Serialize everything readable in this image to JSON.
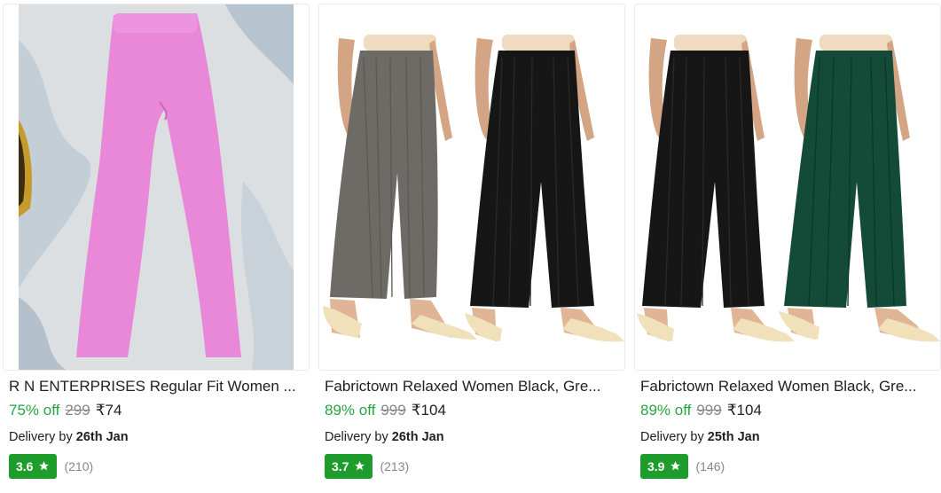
{
  "products": [
    {
      "title": "R N ENTERPRISES Regular Fit Women ...",
      "discount": "75% off",
      "mrp": "299",
      "price": "₹74",
      "delivery_prefix": "Delivery by",
      "delivery_date": "26th Jan",
      "rating": "3.6",
      "reviews": "(210)",
      "image_icon": "pink-trousers-image",
      "colors": [
        "#e987d9"
      ]
    },
    {
      "title": "Fabrictown Relaxed Women Black, Gre...",
      "discount": "89% off",
      "mrp": "999",
      "price": "₹104",
      "delivery_prefix": "Delivery by",
      "delivery_date": "26th Jan",
      "rating": "3.7",
      "reviews": "(213)",
      "image_icon": "grey-black-palazzo-image",
      "colors": [
        "#6e6b66",
        "#161616"
      ]
    },
    {
      "title": "Fabrictown Relaxed Women Black, Gre...",
      "discount": "89% off",
      "mrp": "999",
      "price": "₹104",
      "delivery_prefix": "Delivery by",
      "delivery_date": "25th Jan",
      "rating": "3.9",
      "reviews": "(146)",
      "image_icon": "black-green-palazzo-image",
      "colors": [
        "#161616",
        "#134a38"
      ]
    }
  ],
  "theme": {
    "discount_color": "#26a541",
    "rating_badge_color": "#1f9d2c",
    "muted_text_color": "#878787"
  }
}
